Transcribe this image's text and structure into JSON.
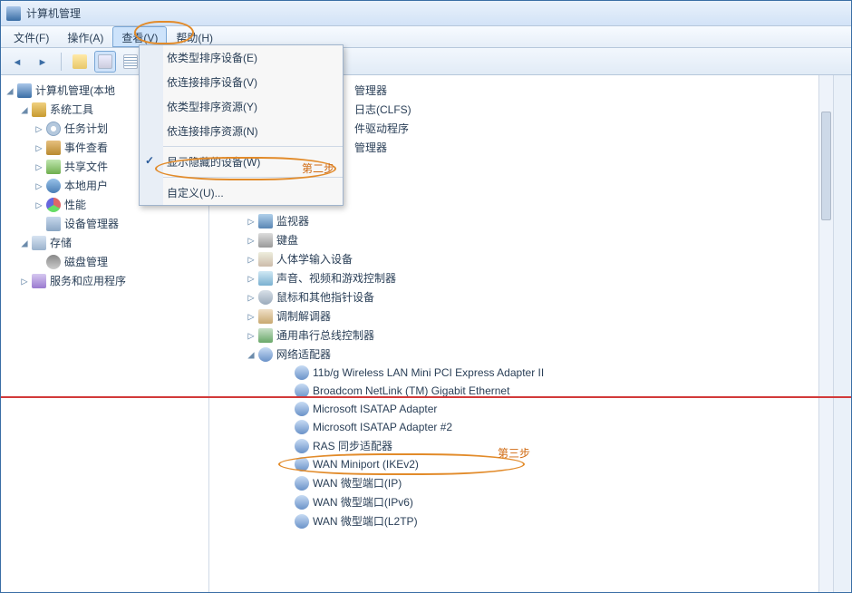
{
  "window": {
    "title": "计算机管理"
  },
  "menubar": {
    "file": "文件(F)",
    "action": "操作(A)",
    "view": "查看(V)",
    "help": "帮助(H)"
  },
  "dropdown": {
    "byTypeDevices": "依类型排序设备(E)",
    "byConnDevices": "依连接排序设备(V)",
    "byTypeResources": "依类型排序资源(Y)",
    "byConnResources": "依连接排序资源(N)",
    "showHidden": "显示隐藏的设备(W)",
    "customize": "自定义(U)..."
  },
  "annotations": {
    "step2": "第二步",
    "step3": "第三步"
  },
  "sidebar": {
    "root": "计算机管理(本地",
    "systemTools": "系统工具",
    "taskScheduler": "任务计划",
    "eventViewer": "事件查看",
    "sharedFolders": "共享文件",
    "localUsers": "本地用户",
    "performance": "性能",
    "deviceManager": "设备管理器",
    "storage": "存储",
    "diskMgmt": "磁盘管理",
    "servicesApps": "服务和应用程序"
  },
  "content": {
    "partialTop": [
      "管理器",
      "日志(CLFS)",
      "件驱动程序",
      "管理器"
    ],
    "items": [
      {
        "icon": "ico-monitor",
        "label": "监视器",
        "expander": "▷"
      },
      {
        "icon": "ico-keyboard",
        "label": "键盘",
        "expander": "▷"
      },
      {
        "icon": "ico-hid",
        "label": "人体学输入设备",
        "expander": "▷"
      },
      {
        "icon": "ico-sound",
        "label": "声音、视频和游戏控制器",
        "expander": "▷"
      },
      {
        "icon": "ico-mouse",
        "label": "鼠标和其他指针设备",
        "expander": "▷"
      },
      {
        "icon": "ico-modem",
        "label": "调制解调器",
        "expander": "▷"
      },
      {
        "icon": "ico-usb",
        "label": "通用串行总线控制器",
        "expander": "▷"
      },
      {
        "icon": "ico-net",
        "label": "网络适配器",
        "expander": "◢"
      }
    ],
    "netAdapters": [
      "11b/g Wireless LAN Mini PCI Express Adapter II",
      "Broadcom NetLink (TM) Gigabit Ethernet",
      "Microsoft ISATAP Adapter",
      "Microsoft ISATAP Adapter #2",
      "RAS 同步适配器",
      "WAN Miniport (IKEv2)",
      "WAN 微型端口(IP)",
      "WAN 微型端口(IPv6)",
      "WAN 微型端口(L2TP)"
    ]
  }
}
